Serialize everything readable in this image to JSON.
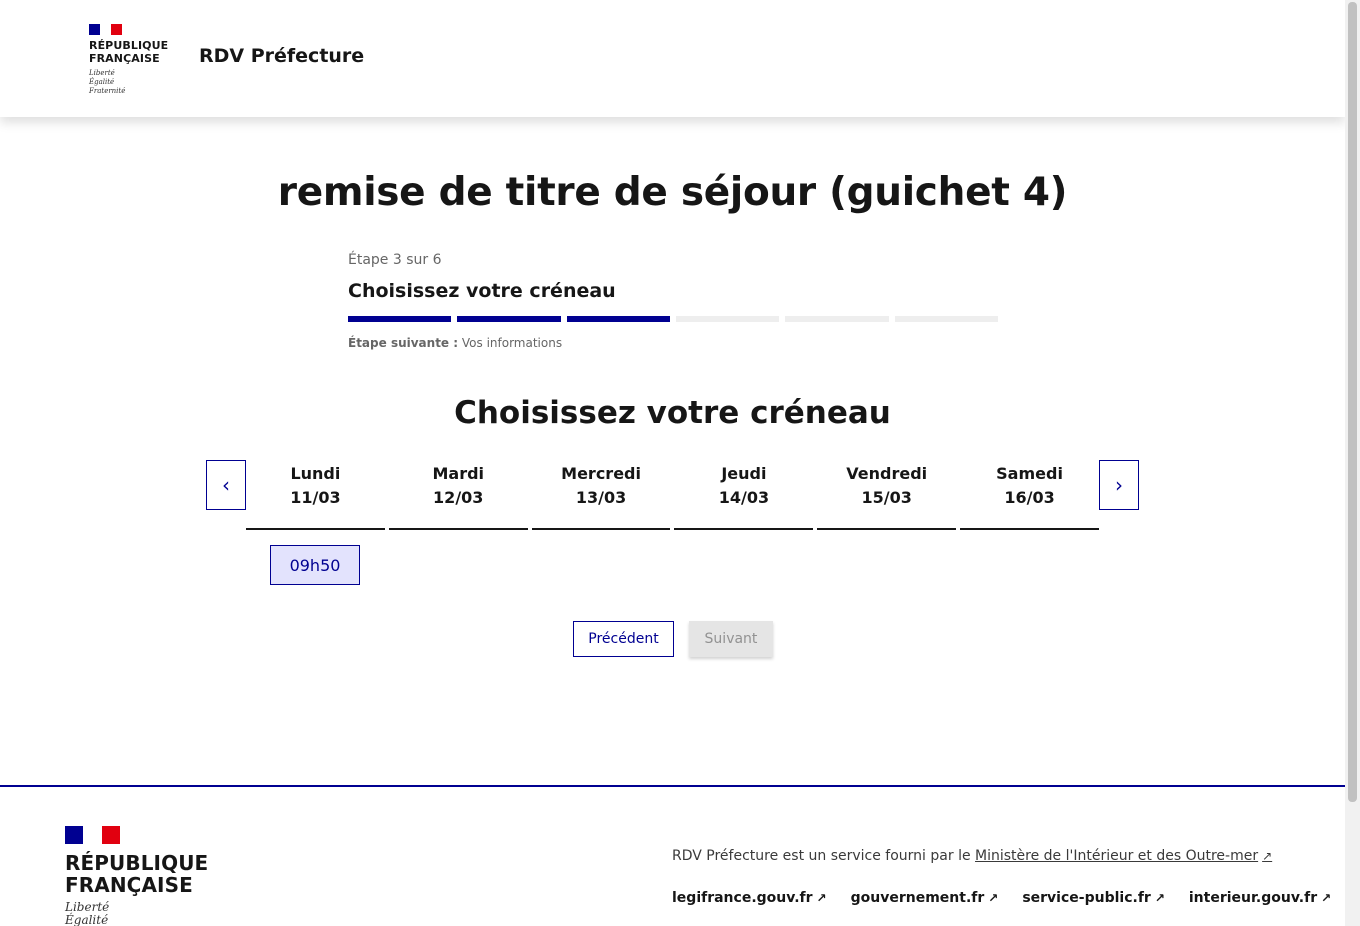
{
  "header": {
    "logo_line1": "RÉPUBLIQUE",
    "logo_line2": "FRANÇAISE",
    "motto1": "Liberté",
    "motto2": "Égalité",
    "motto3": "Fraternité",
    "service_name": "RDV Préfecture"
  },
  "main": {
    "page_title": "remise de titre de séjour (guichet 4)",
    "step_count": "Étape 3 sur 6",
    "step_title": "Choisissez votre créneau",
    "steps_total": 6,
    "steps_done": 3,
    "next_step_label": "Étape suivante :",
    "next_step_value": "Vos informations",
    "section_title": "Choisissez votre créneau"
  },
  "calendar": {
    "days": [
      {
        "name": "Lundi",
        "date": "11/03"
      },
      {
        "name": "Mardi",
        "date": "12/03"
      },
      {
        "name": "Mercredi",
        "date": "13/03"
      },
      {
        "name": "Jeudi",
        "date": "14/03"
      },
      {
        "name": "Vendredi",
        "date": "15/03"
      },
      {
        "name": "Samedi",
        "date": "16/03"
      }
    ],
    "slot": "09h50"
  },
  "actions": {
    "previous_label": "Précédent",
    "next_label": "Suivant"
  },
  "footer": {
    "logo_line1": "RÉPUBLIQUE",
    "logo_line2": "FRANÇAISE",
    "motto1": "Liberté",
    "motto2": "Égalité",
    "desc_text": "RDV Préfecture est un service fourni par le",
    "desc_link": "Ministère de l'Intérieur et des Outre-mer",
    "links": [
      "legifrance.gouv.fr",
      "gouvernement.fr",
      "service-public.fr",
      "interieur.gouv.fr"
    ]
  },
  "colors": {
    "primary": "#000091",
    "marianne_red": "#e1000f",
    "slot_bg": "#e3e3fd",
    "disabled_bg": "#e5e5e5"
  },
  "icons": {
    "prev": "chevron-left-icon",
    "next": "chevron-right-icon",
    "external": "external-link-icon"
  }
}
